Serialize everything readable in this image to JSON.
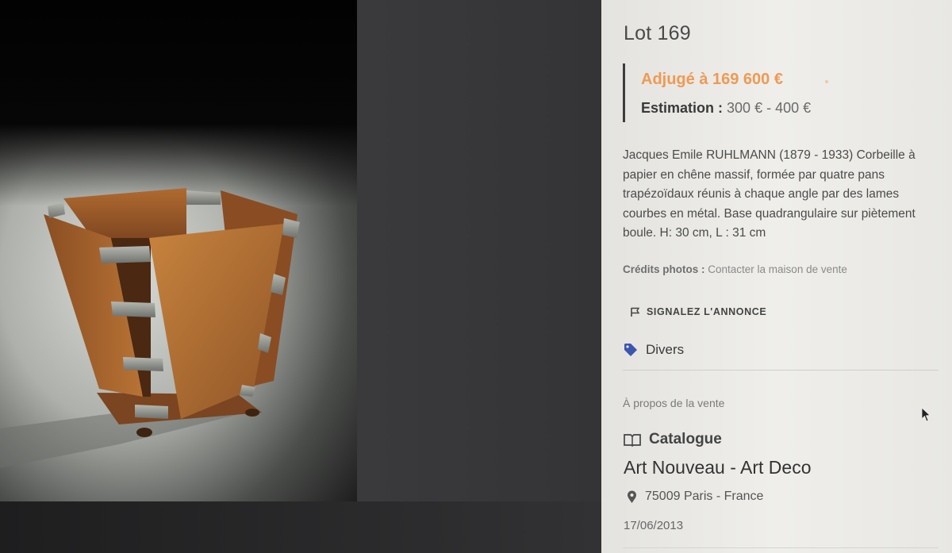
{
  "lot": {
    "title": "Lot 169",
    "sold_label": "Adjugé à 169 600 €",
    "estimate_label": "Estimation :",
    "estimate_value": "300 € - 400 €",
    "description": "Jacques Emile RUHLMANN (1879 - 1933) Corbeille à papier en chêne massif, formée par quatre pans trapézoïdaux réunis à chaque angle par des lames courbes en métal. Base quadrangulaire sur piètement boule. H: 30 cm, L : 31 cm",
    "credits_label": "Crédits photos :",
    "credits_value": "Contacter la maison de vente",
    "report_label": "SIGNALEZ L'ANNONCE",
    "category": "Divers"
  },
  "sale": {
    "about_label": "À propos de la vente",
    "catalogue_label": "Catalogue",
    "name": "Art Nouveau - Art Deco",
    "location": "75009 Paris - France",
    "date": "17/06/2013"
  },
  "icons": {
    "flag": "flag-icon",
    "tag": "tag-icon",
    "book": "book-icon",
    "pin": "map-pin-icon",
    "cursor": "mouse-cursor-icon"
  },
  "colors": {
    "sold_accent": "#ee9a54",
    "tag_icon": "#3b55b0",
    "panel_bg": "#eeede9"
  }
}
